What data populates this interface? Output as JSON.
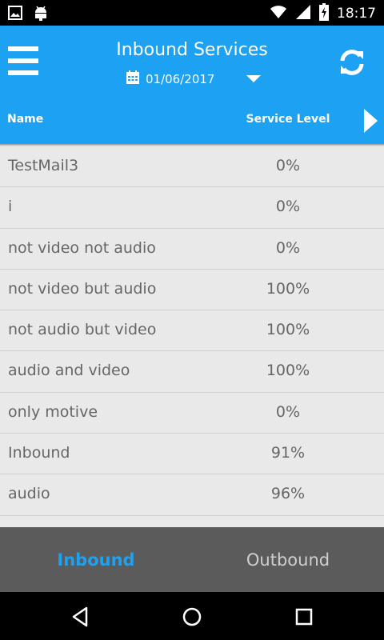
{
  "status_bar": {
    "time": "18:17",
    "icons": [
      "image-icon",
      "android-icon",
      "wifi-icon",
      "signal-icon",
      "battery-charging-icon"
    ]
  },
  "app_bar": {
    "title": "Inbound Services",
    "date": "01/06/2017",
    "accent_color": "#1da1f2"
  },
  "table": {
    "columns": {
      "name": "Name",
      "level": "Service Level"
    },
    "rows": [
      {
        "name": "TestMail3",
        "level": "0%"
      },
      {
        "name": "i",
        "level": "0%"
      },
      {
        "name": "not video not audio",
        "level": "0%"
      },
      {
        "name": "not video but audio",
        "level": "100%"
      },
      {
        "name": "not audio but video",
        "level": "100%"
      },
      {
        "name": "audio and video",
        "level": "100%"
      },
      {
        "name": "only motive",
        "level": "0%"
      },
      {
        "name": "Inbound",
        "level": "91%"
      },
      {
        "name": "audio",
        "level": "96%"
      }
    ]
  },
  "tabs": {
    "inbound": "Inbound",
    "outbound": "Outbound"
  }
}
